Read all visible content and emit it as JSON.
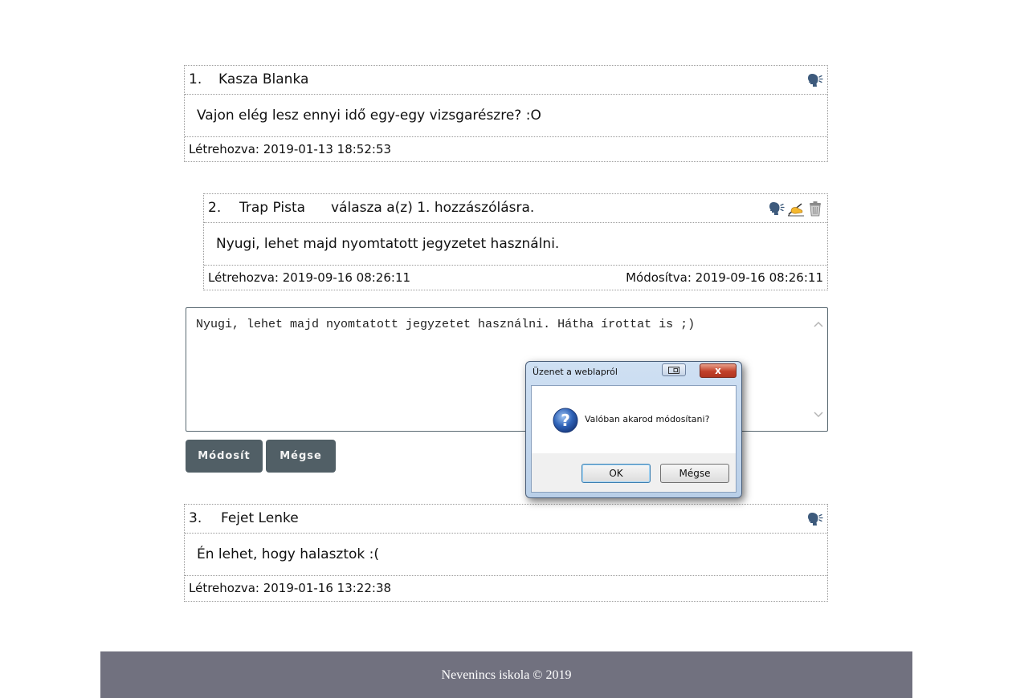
{
  "comments": [
    {
      "num": "1.",
      "author": "Kasza Blanka",
      "text": "Vajon elég lesz ennyi idő egy-egy vizsgarészre? :O",
      "created": "Létrehozva: 2019-01-13 18:52:53"
    },
    {
      "num": "2.",
      "author": "Trap Pista",
      "reply": "válasza a(z) 1. hozzászólásra.",
      "text": "Nyugi, lehet majd nyomtatott jegyzetet használni.",
      "created": "Létrehozva: 2019-09-16 08:26:11",
      "modified": "Módosítva: 2019-09-16 08:26:11"
    },
    {
      "num": "3.",
      "author": "Fejet Lenke",
      "text": "Én lehet, hogy halasztok :(",
      "created": "Létrehozva: 2019-01-16 13:22:38"
    }
  ],
  "icons": {
    "reply": "speaking-head-icon",
    "edit": "writing-hand-icon",
    "delete": "trash-icon"
  },
  "editor": {
    "value": "Nyugi, lehet majd nyomtatott jegyzetet használni. Hátha írottat is ;)"
  },
  "buttons": {
    "modify": "Módosít",
    "cancel": "Mégse"
  },
  "dialog": {
    "title": "Üzenet a weblapról",
    "message": "Valóban akarod módosítani?",
    "ok": "OK",
    "cancel": "Mégse",
    "close": "x"
  },
  "footer": {
    "text": "Nevenincs iskola © 2019"
  },
  "colors": {
    "button_bg": "#515f66",
    "footer_bg": "#71717f"
  }
}
